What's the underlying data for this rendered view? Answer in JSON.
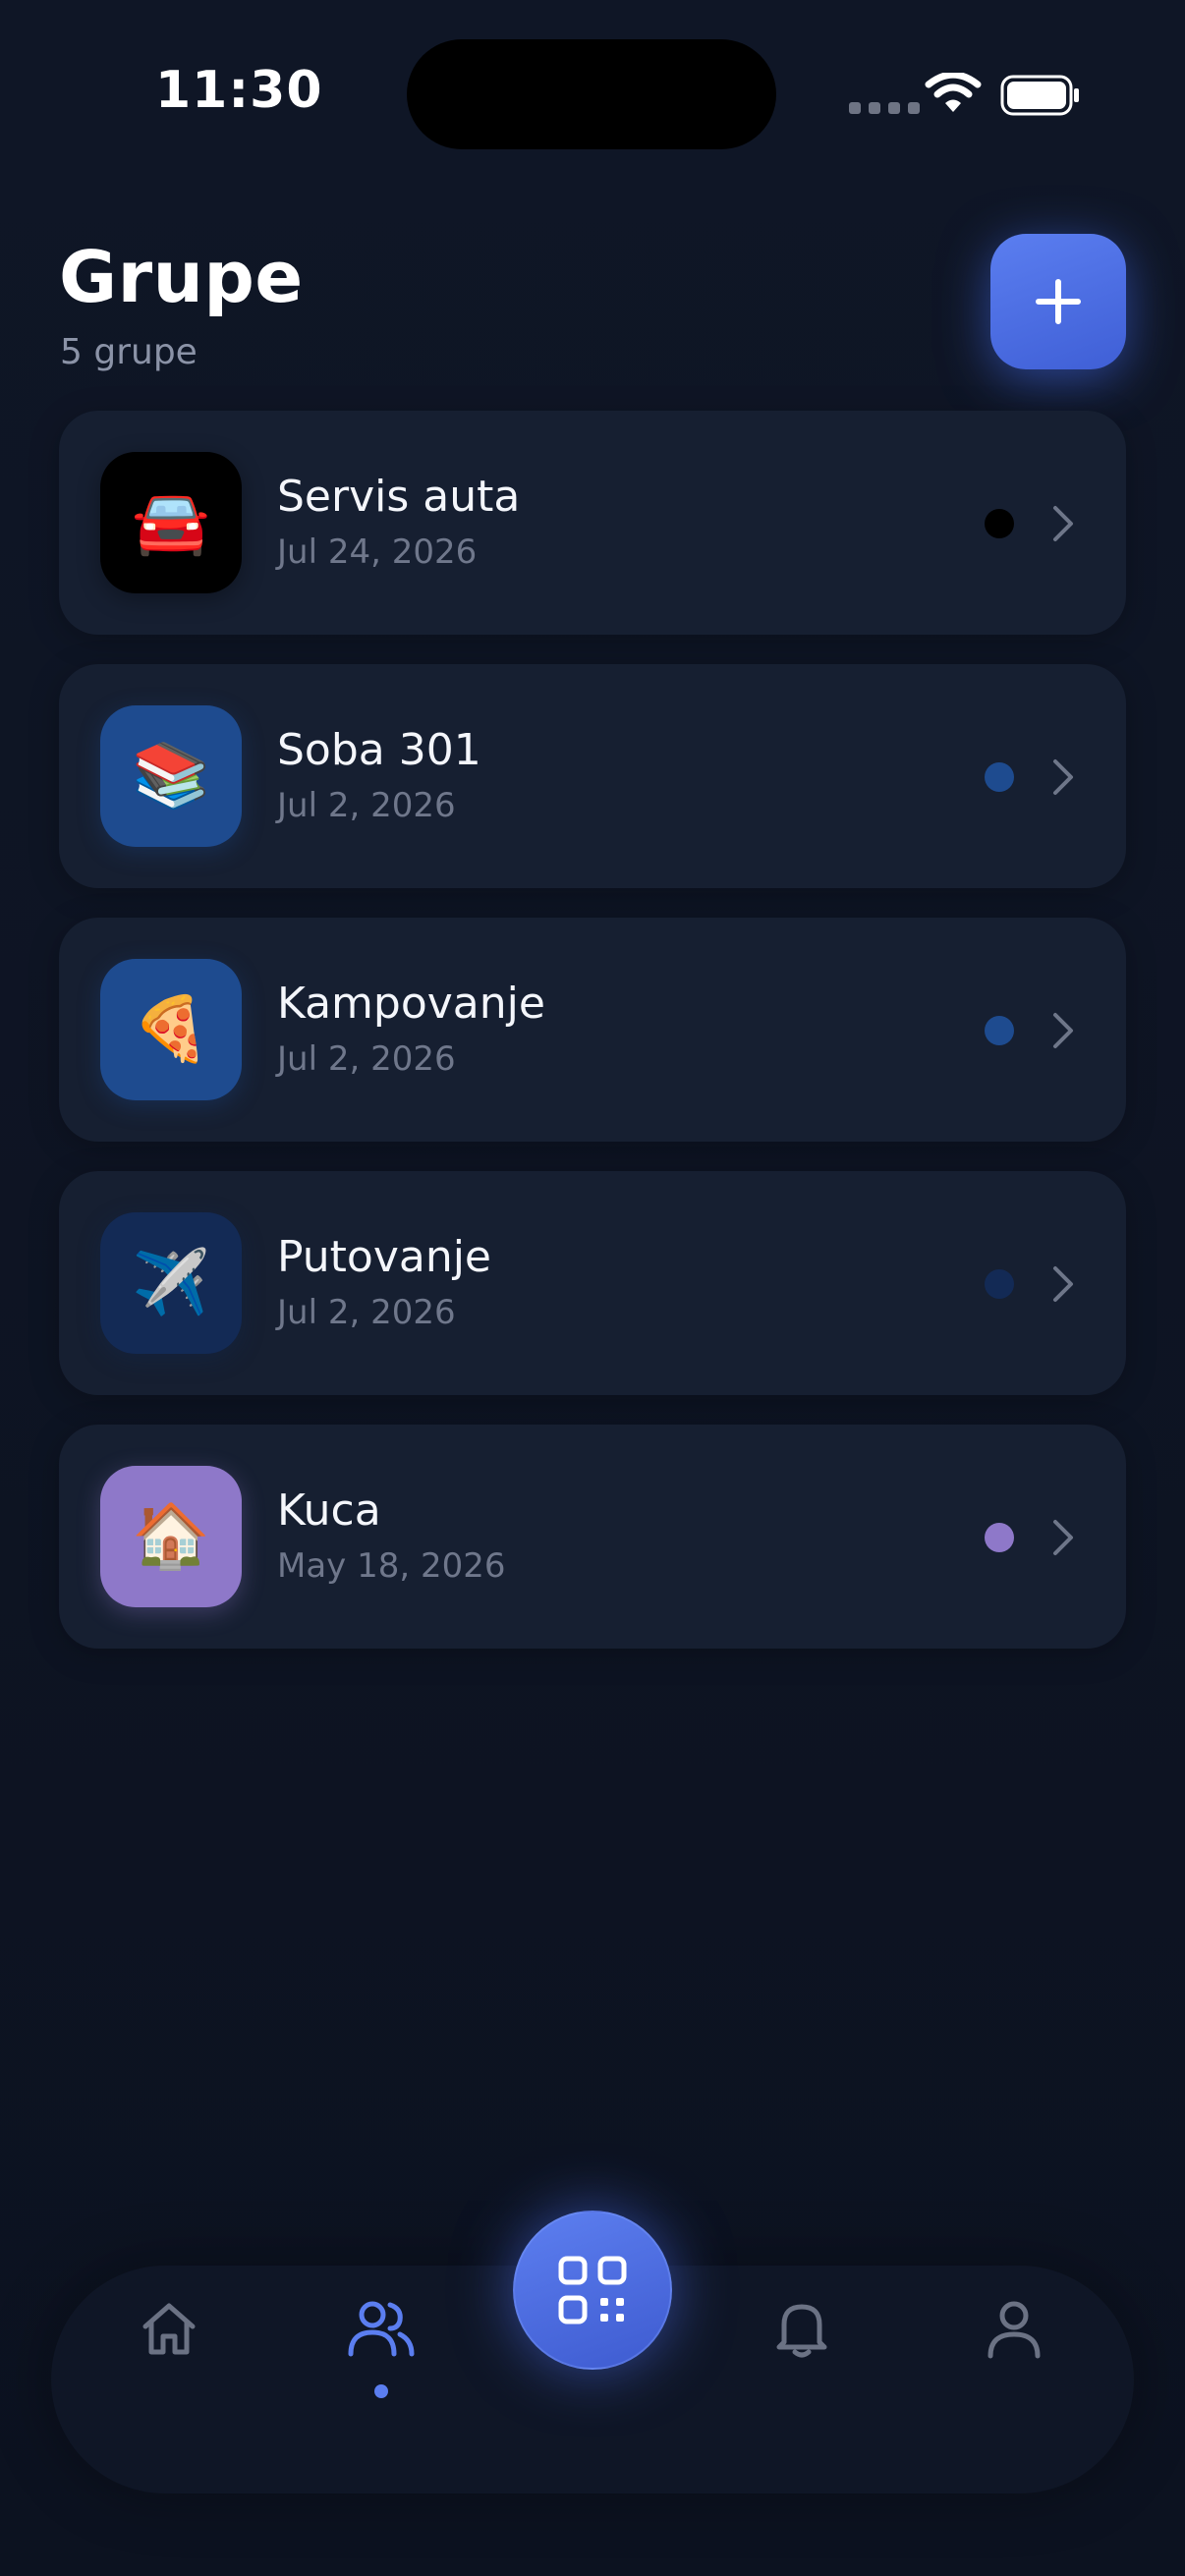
{
  "status_bar": {
    "time": "11:30"
  },
  "header": {
    "title": "Grupe",
    "subtitle": "5 grupe",
    "add_button_icon": "plus-icon"
  },
  "groups": [
    {
      "name": "Servis auta",
      "date": "Jul 24, 2026",
      "emoji": "🚘",
      "avatar_color": "#000000",
      "dot_color": "#000000"
    },
    {
      "name": "Soba 301",
      "date": "Jul 2, 2026",
      "emoji": "📚",
      "avatar_color": "#1e4b8f",
      "dot_color": "#1e4b8f"
    },
    {
      "name": "Kampovanje",
      "date": "Jul 2, 2026",
      "emoji": "🍕",
      "avatar_color": "#1e4b8f",
      "dot_color": "#1e4b8f"
    },
    {
      "name": "Putovanje",
      "date": "Jul 2, 2026",
      "emoji": "✈️",
      "avatar_color": "#132a55",
      "dot_color": "#132a55"
    },
    {
      "name": "Kuca",
      "date": "May 18, 2026",
      "emoji": "🏠",
      "avatar_color": "#8e78c9",
      "dot_color": "#8e78c9"
    }
  ],
  "bottom_nav": {
    "items": [
      {
        "icon": "home-icon",
        "active": false
      },
      {
        "icon": "users-icon",
        "active": true
      },
      {
        "icon": "qr-scan-icon",
        "active": false
      },
      {
        "icon": "bell-icon",
        "active": false
      },
      {
        "icon": "profile-icon",
        "active": false
      }
    ],
    "accent_color": "#5b7ef0",
    "inactive_color": "#6b7284"
  }
}
